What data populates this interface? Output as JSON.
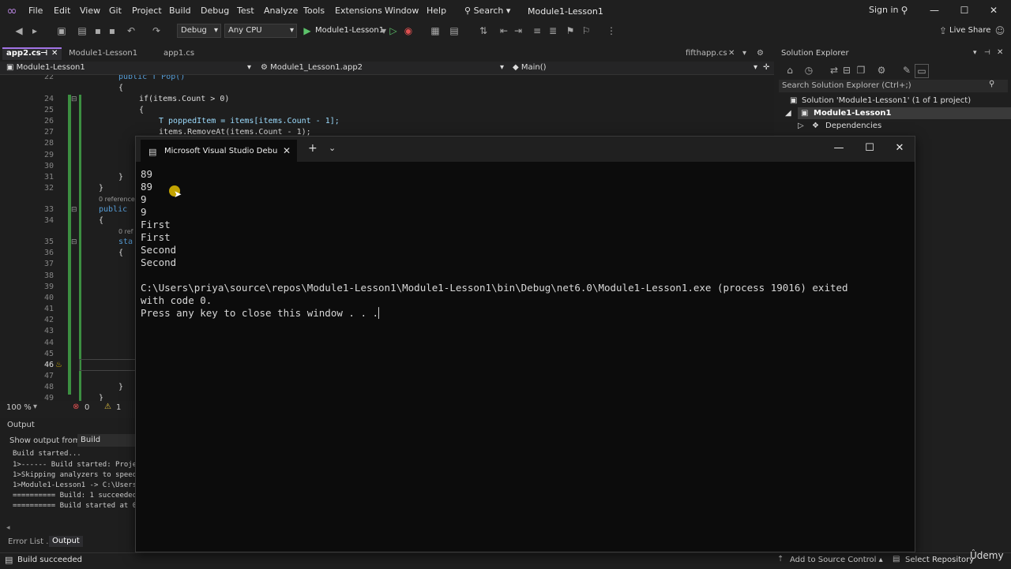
{
  "menubar": {
    "items": [
      "File",
      "Edit",
      "View",
      "Git",
      "Project",
      "Build",
      "Debug",
      "Test",
      "Analyze",
      "Tools",
      "Extensions",
      "Window",
      "Help"
    ],
    "search": "Search",
    "title": "Module1-Lesson1",
    "sign_in": "Sign in",
    "minimize": "—",
    "maximize": "☐",
    "close": "✕"
  },
  "toolbar": {
    "configuration": "Debug",
    "platform": "Any CPU",
    "run_target": "Module1-Lesson1",
    "live_share": "Live Share"
  },
  "tabs": {
    "app2": "app2.cs",
    "module": "Module1-Lesson1",
    "app1": "app1.cs",
    "fifthapp": "fifthapp.cs"
  },
  "navbar": {
    "project": "Module1-Lesson1",
    "class": "Module1_Lesson1.app2",
    "member": "Main()"
  },
  "editor": {
    "line_numbers": [
      "22",
      "24",
      "25",
      "26",
      "27",
      "28",
      "29",
      "30",
      "31",
      "32",
      "33",
      "34",
      "35",
      "36",
      "37",
      "38",
      "39",
      "40",
      "41",
      "42",
      "43",
      "44",
      "45",
      "46",
      "47",
      "48",
      "49"
    ],
    "code_l22": "public T Pop()",
    "code_l23": "{",
    "code_l24": "if(items.Count > 0)",
    "code_l25": "{",
    "code_l26": "T poppedItem = items[items.Count - 1];",
    "code_l27": "items.RemoveAt(items.Count - 1);",
    "code_l31": "}",
    "code_l32": "}",
    "ref1": "0 reference",
    "code_l33": "public",
    "code_l34": "{",
    "ref2": "0 ref",
    "code_l35": "sta",
    "code_l36": "{",
    "code_l48": "}",
    "code_l49": "}"
  },
  "editor_status": {
    "zoom": "100 %",
    "errors": "0",
    "warnings": "1"
  },
  "output": {
    "title": "Output",
    "show_from_label": "Show output from:",
    "source": "Build",
    "lines": [
      "Build started...",
      "1>------ Build started: Proje",
      "1>Skipping analyzers to speed",
      "1>Module1-Lesson1 -> C:\\Users",
      "========== Build: 1 succeeded",
      "========== Build started at 0"
    ],
    "tab_error_list": "Error List ...",
    "tab_output": "Output"
  },
  "solution_explorer": {
    "title": "Solution Explorer",
    "search_placeholder": "Search Solution Explorer (Ctrl+;)",
    "solution": "Solution 'Module1-Lesson1' (1 of 1 project)",
    "project": "Module1-Lesson1",
    "dependencies": "Dependencies"
  },
  "statusbar": {
    "status": "Build succeeded",
    "add_to_source": "Add to Source Control",
    "select_repo": "Select Repository",
    "watermark": "Ûdemy"
  },
  "console": {
    "title": "Microsoft Visual Studio Debu",
    "lines": [
      "89",
      "89",
      "9",
      "9",
      "First",
      "First",
      "Second",
      "Second",
      "",
      "C:\\Users\\priya\\source\\repos\\Module1-Lesson1\\Module1-Lesson1\\bin\\Debug\\net6.0\\Module1-Lesson1.exe (process 19016) exited",
      "with code 0.",
      "Press any key to close this window . . ."
    ]
  },
  "colors": {
    "background": "#1f1f1f",
    "console_bg": "#0c0c0c",
    "accent": "#a274e6",
    "change_bar": "#3c8f41",
    "cursor_highlight": "#d6b400"
  }
}
